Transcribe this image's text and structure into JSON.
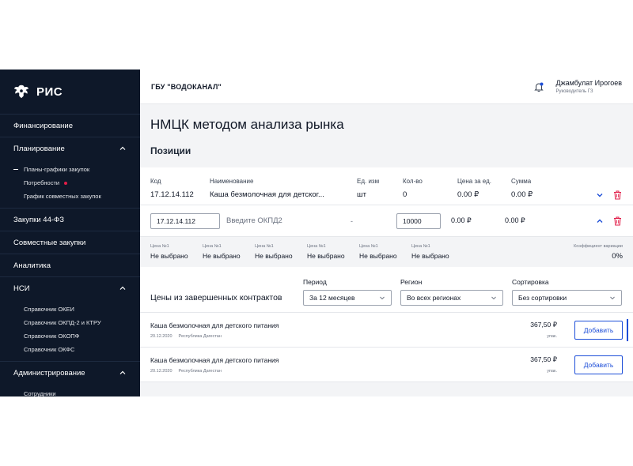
{
  "sidebar": {
    "logo_text": "РИС",
    "items": [
      {
        "label": "Финансирование"
      },
      {
        "label": "Планирование"
      },
      {
        "label": "Закупки 44-ФЗ"
      },
      {
        "label": "Совместные закупки"
      },
      {
        "label": "Аналитика"
      },
      {
        "label": "НСИ"
      },
      {
        "label": "Администрирование"
      }
    ],
    "planning_sub": {
      "plans": "Планы-графики закупок",
      "needs": "Потребности",
      "joint_schedule": "График совместных закупок"
    },
    "nsi_sub": [
      "Справочник ОКЕИ",
      "Справочник ОКПД-2 и КТРУ",
      "Справочник ОКОПФ",
      "Справочник ОКФС"
    ],
    "admin_sub": [
      "Сотрудники"
    ]
  },
  "header": {
    "org": "ГБУ \"ВОДОКАНАЛ\"",
    "user_name": "Джамбулат Ирогоев",
    "user_role": "Руководитель ГЗ"
  },
  "page": {
    "title": "НМЦК методом анализа рынка",
    "positions_title": "Позиции"
  },
  "positions": {
    "headers": {
      "code": "Код",
      "name": "Наименование",
      "unit": "Ед. изм",
      "qty": "Кол-во",
      "price": "Цена за ед.",
      "sum": "Сумма"
    },
    "row": {
      "code": "17.12.14.112",
      "name": "Каша безмолочная для детског...",
      "unit": "шт",
      "qty": "0",
      "price": "0.00 ₽",
      "sum": "0.00 ₽"
    },
    "edit": {
      "code": "17.12.14.112",
      "okpd_placeholder": "Введите ОКПД2",
      "unit": "-",
      "qty": "10000",
      "price": "0.00 ₽",
      "sum": "0.00 ₽"
    },
    "price_cols": [
      {
        "label": "Цена №1",
        "value": "Не выбрано"
      },
      {
        "label": "Цена №1",
        "value": "Не выбрано"
      },
      {
        "label": "Цена №1",
        "value": "Не выбрано"
      },
      {
        "label": "Цена №1",
        "value": "Не выбрано"
      },
      {
        "label": "Цена №1",
        "value": "Не выбрано"
      },
      {
        "label": "Цена №1",
        "value": "Не выбрано"
      }
    ],
    "coef_label": "Коэффициент вариации",
    "coef_value": "0%"
  },
  "contracts": {
    "title": "Цены из завершенных контрактов",
    "period_label": "Период",
    "period_value": "За 12 месяцев",
    "region_label": "Регион",
    "region_value": "Во всех регионах",
    "sort_label": "Сортировка",
    "sort_value": "Без сортировки",
    "items": [
      {
        "title": "Каша безмолочная для детского питания",
        "date": "20.12.2020",
        "region": "Республика Дагестан",
        "amount": "367,50 ₽",
        "unit": "упак.",
        "button": "Добавить"
      },
      {
        "title": "Каша безмолочная для детского питания",
        "date": "20.12.2020",
        "region": "Республика Дагестан",
        "amount": "367,50 ₽",
        "unit": "упак.",
        "button": "Добавить"
      }
    ]
  },
  "colors": {
    "sidebar_bg": "#0e1829",
    "accent": "#1d4ed8",
    "danger": "#e11d48"
  }
}
